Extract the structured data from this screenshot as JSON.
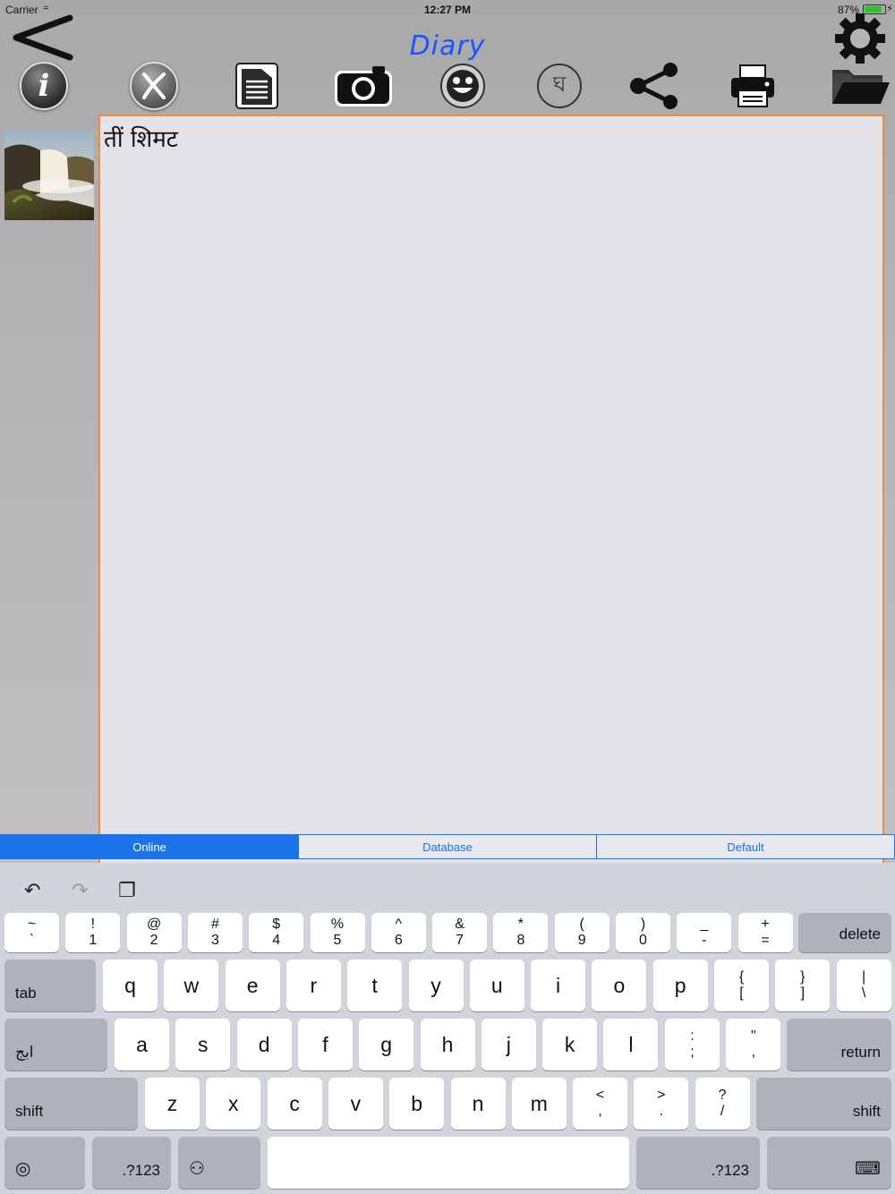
{
  "status": {
    "carrier": "Carrier",
    "time": "12:27 PM",
    "battery": "87%",
    "battery_level": 0.87
  },
  "header": {
    "title": "Diary"
  },
  "toolbar": [
    "info-icon",
    "close-icon",
    "document-icon",
    "camera-icon",
    "emoji-icon",
    "language-icon",
    "share-icon",
    "print-icon",
    "folder-icon"
  ],
  "toolbar_glyphs": {
    "language": "ঘ"
  },
  "editor": {
    "text": "तीं शिमट"
  },
  "segments": {
    "online": "Online",
    "database": "Database",
    "default": "Default"
  },
  "keyboard": {
    "row1": [
      {
        "top": "~",
        "bottom": "`"
      },
      {
        "top": "!",
        "bottom": "1"
      },
      {
        "top": "@",
        "bottom": "2"
      },
      {
        "top": "#",
        "bottom": "3"
      },
      {
        "top": "$",
        "bottom": "4"
      },
      {
        "top": "%",
        "bottom": "5"
      },
      {
        "top": "^",
        "bottom": "6"
      },
      {
        "top": "&",
        "bottom": "7"
      },
      {
        "top": "*",
        "bottom": "8"
      },
      {
        "top": "(",
        "bottom": "9"
      },
      {
        "top": ")",
        "bottom": "0"
      },
      {
        "top": "_",
        "bottom": "-"
      },
      {
        "top": "+",
        "bottom": "="
      }
    ],
    "delete": "delete",
    "tab": "tab",
    "row2": [
      "q",
      "w",
      "e",
      "r",
      "t",
      "y",
      "u",
      "i",
      "o",
      "p"
    ],
    "row2_extra": [
      {
        "top": "{",
        "bottom": "["
      },
      {
        "top": "}",
        "bottom": "]"
      },
      {
        "top": "|",
        "bottom": "\\"
      }
    ],
    "lang": "ابج",
    "row3": [
      "a",
      "s",
      "d",
      "f",
      "g",
      "h",
      "j",
      "k",
      "l"
    ],
    "row3_extra": [
      {
        "top": ":",
        "bottom": ";"
      },
      {
        "top": "\"",
        "bottom": ","
      }
    ],
    "return": "return",
    "shift": "shift",
    "row4": [
      "z",
      "x",
      "c",
      "v",
      "b",
      "n",
      "m"
    ],
    "row4_extra": [
      {
        "top": "<",
        "bottom": ","
      },
      {
        "top": ">",
        "bottom": "."
      },
      {
        "top": "?",
        "bottom": "/"
      }
    ],
    "numbers": ".?123"
  }
}
